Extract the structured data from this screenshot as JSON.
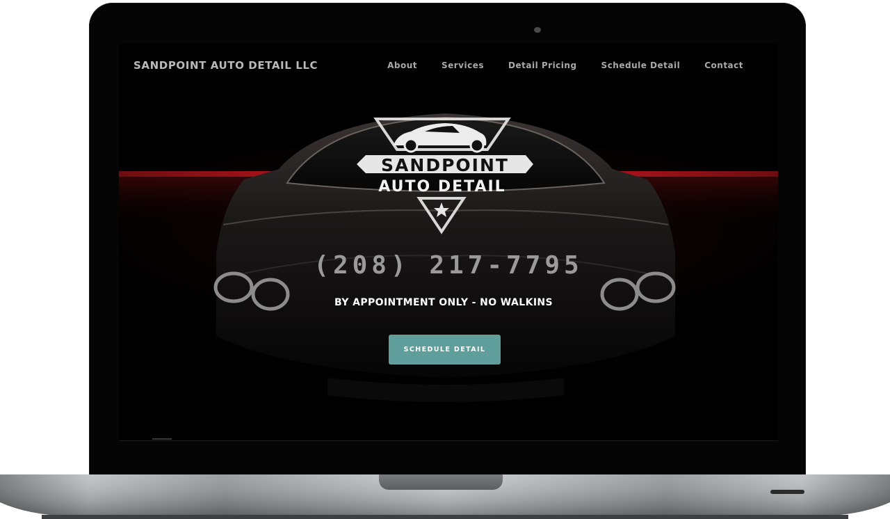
{
  "site": {
    "brand": "SANDPOINT AUTO DETAIL LLC",
    "nav": [
      {
        "label": "About"
      },
      {
        "label": "Services"
      },
      {
        "label": "Detail Pricing"
      },
      {
        "label": "Schedule Detail"
      },
      {
        "label": "Contact"
      }
    ],
    "logo": {
      "line1": "SANDPOINT",
      "line2": "AUTO DETAIL"
    },
    "phone": "(208) 217-7795",
    "tagline": "BY APPOINTMENT ONLY - NO WALKINS",
    "cta_label": "SCHEDULE DETAIL"
  },
  "colors": {
    "accent": "#5f9e9a",
    "red_stripe": "#b0121a",
    "background": "#000000"
  },
  "icons": [
    "car-logo-icon",
    "star-icon"
  ]
}
